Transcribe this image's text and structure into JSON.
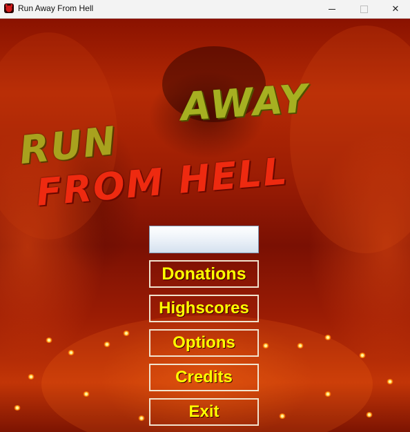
{
  "window": {
    "title": "Run Away From Hell",
    "controls": {
      "minimize_icon": "minimize-icon",
      "maximize_icon": "maximize-icon",
      "close_icon": "close-icon",
      "close_glyph": "✕"
    }
  },
  "logo": {
    "line1_word1": "RUN",
    "line1_word2": "AWAY",
    "line2": "FROM HELL",
    "colors": {
      "top": "#a8a21e",
      "bottom": "#ee2a10"
    }
  },
  "menu": {
    "name_input": {
      "value": "",
      "placeholder": ""
    },
    "buttons": [
      {
        "label": "Donations"
      },
      {
        "label": "Highscores"
      },
      {
        "label": "Options"
      },
      {
        "label": "Credits"
      },
      {
        "label": "Exit"
      }
    ],
    "button_text_color": "#ffff00"
  }
}
